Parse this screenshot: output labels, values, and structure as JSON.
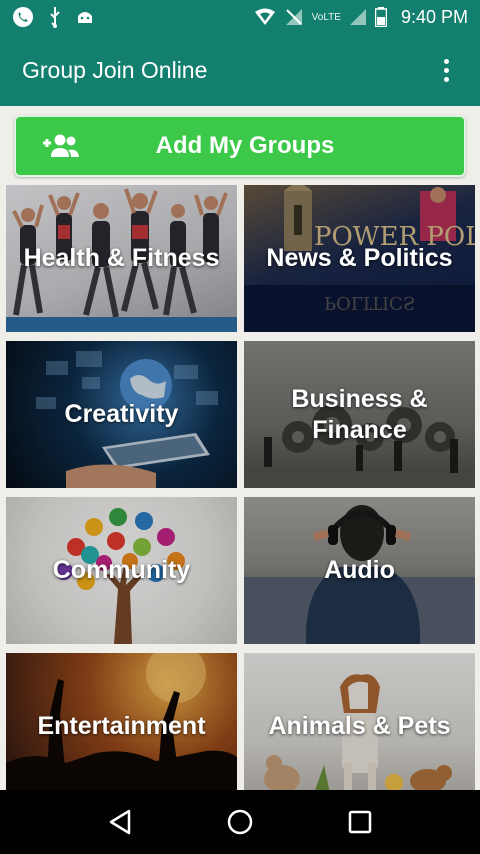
{
  "status_bar": {
    "network_label": "VoLTE",
    "time": "9:40 PM",
    "left_icons": [
      "whatsapp-icon",
      "usb-icon",
      "android-icon"
    ],
    "right_icons": [
      "wifi-hotspot-icon",
      "no-signal-icon",
      "signal-icon",
      "battery-icon"
    ]
  },
  "app_bar": {
    "title": "Group Join Online",
    "menu_icon": "overflow-menu-icon"
  },
  "add_button": {
    "label": "Add My Groups",
    "icon": "add-group-icon"
  },
  "categories": [
    {
      "label": "Health & Fitness"
    },
    {
      "label": "News & Politics"
    },
    {
      "label": "Creativity"
    },
    {
      "label": "Business & Finance"
    },
    {
      "label": "Community"
    },
    {
      "label": "Audio"
    },
    {
      "label": "Entertainment"
    },
    {
      "label": "Animals & Pets"
    }
  ],
  "tile_image_text": {
    "news_politics": "POWER POLITICS"
  },
  "nav_bar": {
    "icons": [
      "back-icon",
      "home-icon",
      "recents-icon"
    ]
  },
  "colors": {
    "primary": "#13806f",
    "button": "#3cc94a",
    "background": "#efeee9"
  }
}
